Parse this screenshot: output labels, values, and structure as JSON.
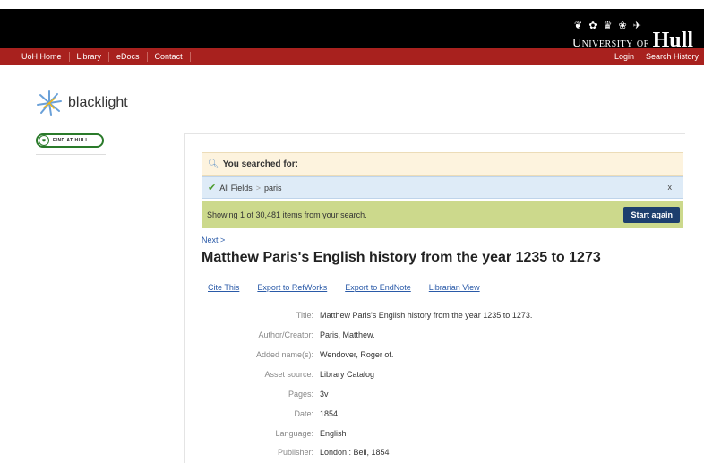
{
  "header": {
    "university_small": "University of",
    "university_big": "Hull",
    "crest_glyphs": "❦ ✿ ♛ ❀ ✈"
  },
  "nav": {
    "left": [
      "UoH Home",
      "Library",
      "eDocs",
      "Contact"
    ],
    "right": [
      "Login",
      "Search History"
    ]
  },
  "sidebar": {
    "logo_text": "blacklight",
    "find_at_hull": "FIND AT HULL"
  },
  "search": {
    "searched_for_label": "You searched for:",
    "field_name": "All Fields",
    "field_separator": ">",
    "field_value": "paris",
    "remove_label": "x",
    "showing_text": "Showing 1 of 30,481 items from your search.",
    "start_again_label": "Start again"
  },
  "record": {
    "next_label": "Next >",
    "title": "Matthew Paris's English history from the year 1235 to 1273",
    "tools": [
      "Cite This",
      "Export to RefWorks",
      "Export to EndNote",
      "Librarian View"
    ],
    "fields": [
      {
        "label": "Title:",
        "value": "Matthew Paris's English history from the year 1235 to 1273."
      },
      {
        "label": "Author/Creator:",
        "value": "Paris, Matthew."
      },
      {
        "label": "Added name(s):",
        "value": "Wendover, Roger of."
      },
      {
        "label": "Asset source:",
        "value": "Library Catalog"
      },
      {
        "label": "Pages:",
        "value": "3v"
      },
      {
        "label": "Date:",
        "value": "1854"
      },
      {
        "label": "Language:",
        "value": "English"
      },
      {
        "label": "Publisher:",
        "value": "London : Bell, 1854"
      }
    ]
  },
  "colors": {
    "topbar": "#000000",
    "navbar": "#a8211e",
    "searched_bg": "#fdf3de",
    "fields_bg": "#deebf7",
    "showing_bg": "#ccd98c",
    "start_again_bg": "#1d3f6e",
    "link": "#2a5aa8"
  }
}
